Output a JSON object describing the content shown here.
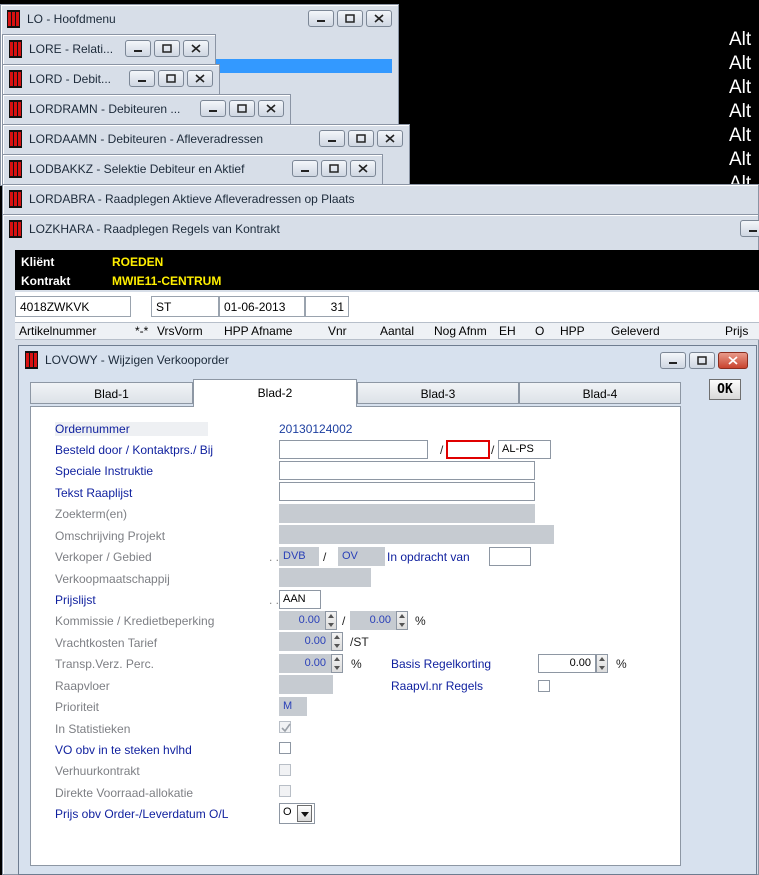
{
  "alt_lines": [
    "Alt",
    "Alt",
    "Alt",
    "Alt",
    "Alt",
    "Alt",
    "Alt"
  ],
  "windows": [
    {
      "title": "LO - Hoofdmenu"
    },
    {
      "title": "LORE - Relati..."
    },
    {
      "title": "LORD - Debit..."
    },
    {
      "title": "LORDRAMN - Debiteuren ..."
    },
    {
      "title": "LORDAAMN - Debiteuren - Afleveradressen"
    },
    {
      "title": "LODBAKKZ - Selektie Debiteur en Aktief"
    },
    {
      "title": "LORDABRA - Raadplegen Aktieve Afleveradressen op Plaats"
    },
    {
      "title": "LOZKHARA - Raadplegen Regels van Kontrakt"
    }
  ],
  "client": {
    "label": "Kliënt",
    "value": "ROEDEN"
  },
  "contract": {
    "label": "Kontrakt",
    "value": "MWIE11-CENTRUM"
  },
  "info": {
    "code": "4018ZWKVK",
    "st": "ST",
    "date": "01-06-2013",
    "count": "31"
  },
  "columns": [
    "Artikelnummer",
    "*-*",
    "VrsVorm",
    "HPP Afname",
    "Vnr",
    "Aantal",
    "Nog Afnm",
    "EH",
    "O",
    "HPP",
    "Geleverd",
    "Prijs"
  ],
  "dialog": {
    "title": "LOVOWY - Wijzigen Verkooporder",
    "ok_label": "OK",
    "tabs": [
      "Blad-1",
      "Blad-2",
      "Blad-3",
      "Blad-4"
    ],
    "fields": {
      "ordernummer": {
        "label": "Ordernummer",
        "value": "20130124002"
      },
      "besteld": {
        "label": "Besteld door / Kontaktprs./ Bij",
        "value1": "",
        "value2": "",
        "value3": "AL-PS"
      },
      "speciale": {
        "label": "Speciale Instruktie",
        "value": ""
      },
      "tekst": {
        "label": "Tekst Raaplijst",
        "value": ""
      },
      "zoekterm": {
        "label": "Zoekterm(en)",
        "value": ""
      },
      "omschrijving": {
        "label": "Omschrijving Projekt",
        "value": ""
      },
      "verkoper": {
        "label": "Verkoper / Gebied",
        "value1": "DVB",
        "value2": "OV"
      },
      "opdracht": {
        "label": "In opdracht van",
        "value": ""
      },
      "verkoopmaatschappij": {
        "label": "Verkoopmaatschappij",
        "value": ""
      },
      "prijslijst": {
        "label": "Prijslijst",
        "value": "AAN"
      },
      "kommissie": {
        "label": "Kommissie / Kredietbeperking",
        "value1": "0.00",
        "value2": "0.00",
        "unit": "%"
      },
      "vracht": {
        "label": "Vrachtkosten Tarief",
        "value": "0.00",
        "unit": "/ST"
      },
      "transp": {
        "label": "Transp.Verz. Perc.",
        "value": "0.00",
        "unit": "%"
      },
      "basis": {
        "label": "Basis Regelkorting",
        "value": "0.00",
        "unit": "%"
      },
      "raapvloer": {
        "label": "Raapvloer",
        "value": ""
      },
      "raapvl_nr": {
        "label": "Raapvl.nr Regels"
      },
      "prioriteit": {
        "label": "Prioriteit",
        "value": "M"
      },
      "statistieken": {
        "label": "In Statistieken"
      },
      "vo": {
        "label": "VO obv in te steken hvlhd"
      },
      "verhuur": {
        "label": "Verhuurkontrakt"
      },
      "direkte": {
        "label": "Direkte Voorraad-allokatie"
      },
      "prijs_obv": {
        "label": "Prijs obv Order-/Leverdatum O/L",
        "value": "O"
      }
    }
  }
}
